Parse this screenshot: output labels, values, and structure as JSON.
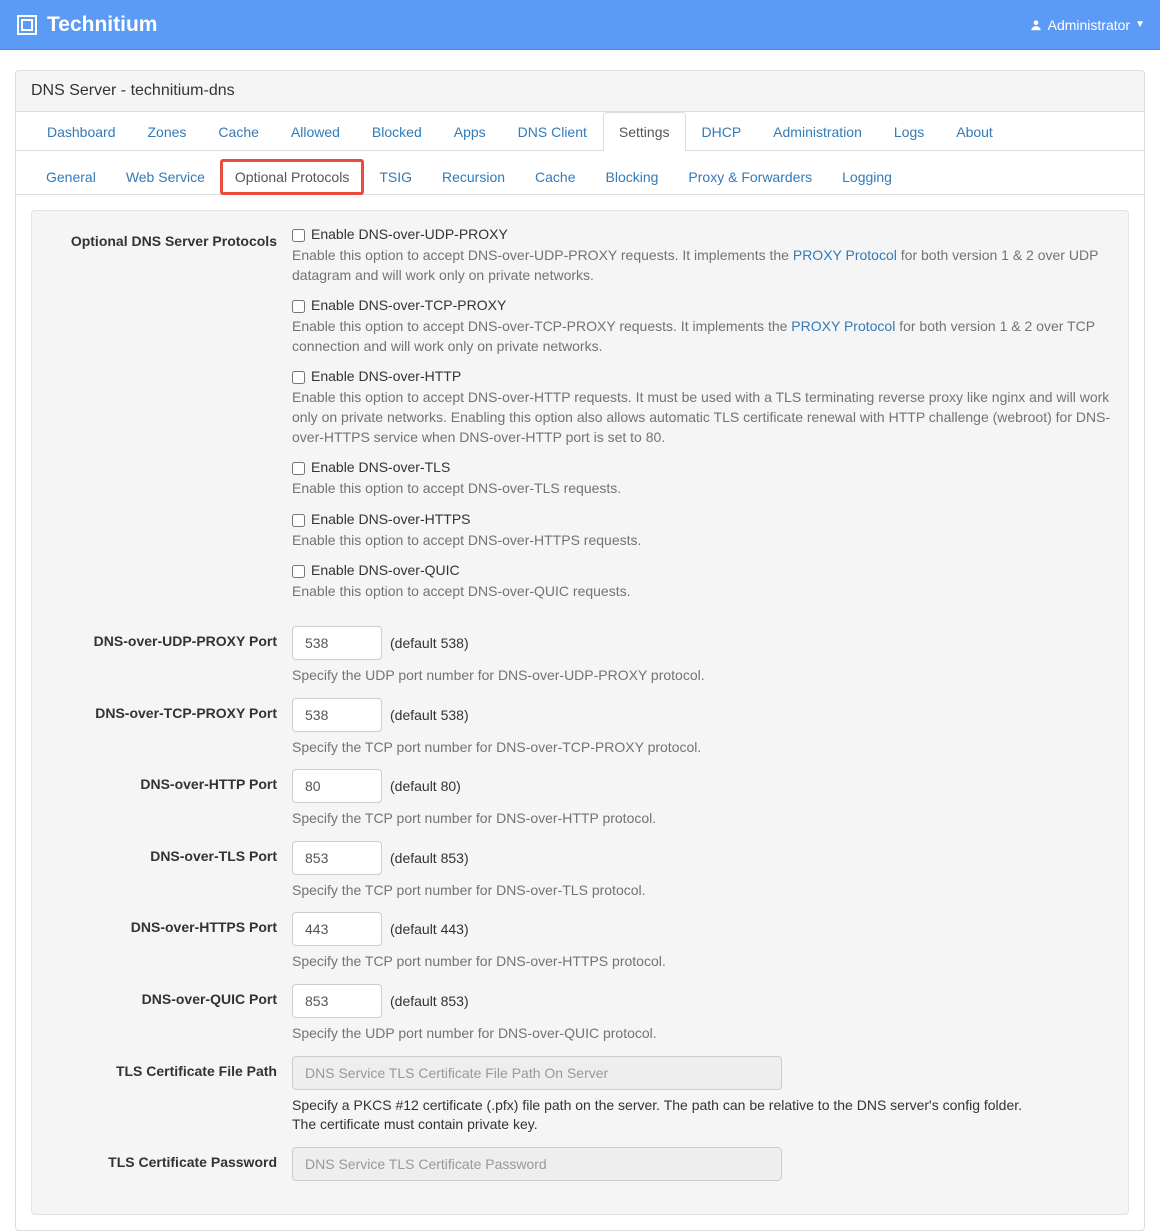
{
  "brand": "Technitium",
  "user": "Administrator",
  "page_title": "DNS Server - technitium-dns",
  "main_tabs": [
    {
      "label": "Dashboard"
    },
    {
      "label": "Zones"
    },
    {
      "label": "Cache"
    },
    {
      "label": "Allowed"
    },
    {
      "label": "Blocked"
    },
    {
      "label": "Apps"
    },
    {
      "label": "DNS Client"
    },
    {
      "label": "Settings",
      "active": true
    },
    {
      "label": "DHCP"
    },
    {
      "label": "Administration"
    },
    {
      "label": "Logs"
    },
    {
      "label": "About"
    }
  ],
  "sub_tabs": [
    {
      "label": "General"
    },
    {
      "label": "Web Service"
    },
    {
      "label": "Optional Protocols",
      "highlighted": true
    },
    {
      "label": "TSIG"
    },
    {
      "label": "Recursion"
    },
    {
      "label": "Cache"
    },
    {
      "label": "Blocking"
    },
    {
      "label": "Proxy & Forwarders"
    },
    {
      "label": "Logging"
    }
  ],
  "section_label": "Optional DNS Server Protocols",
  "proxy_link_label": "PROXY Protocol",
  "checkboxes": [
    {
      "label": "Enable DNS-over-UDP-PROXY",
      "help_pre": "Enable this option to accept DNS-over-UDP-PROXY requests. It implements the ",
      "help_post": "for both version 1 & 2 over UDP datagram and will work only on private networks.",
      "has_link": true
    },
    {
      "label": "Enable DNS-over-TCP-PROXY",
      "help_pre": "Enable this option to accept DNS-over-TCP-PROXY requests. It implements the ",
      "help_post": "for both version 1 & 2 over TCP connection and will work only on private networks.",
      "has_link": true
    },
    {
      "label": "Enable DNS-over-HTTP",
      "help_full": "Enable this option to accept DNS-over-HTTP requests. It must be used with a TLS terminating reverse proxy like nginx and will work only on private networks. Enabling this option also allows automatic TLS certificate renewal with HTTP challenge (webroot) for DNS-over-HTTPS service when DNS-over-HTTP port is set to 80."
    },
    {
      "label": "Enable DNS-over-TLS",
      "help_full": "Enable this option to accept DNS-over-TLS requests."
    },
    {
      "label": "Enable DNS-over-HTTPS",
      "help_full": "Enable this option to accept DNS-over-HTTPS requests."
    },
    {
      "label": "Enable DNS-over-QUIC",
      "help_full": "Enable this option to accept DNS-over-QUIC requests."
    }
  ],
  "ports": [
    {
      "label": "DNS-over-UDP-PROXY Port",
      "value": "538",
      "default": "(default 538)",
      "help": "Specify the UDP port number for DNS-over-UDP-PROXY protocol."
    },
    {
      "label": "DNS-over-TCP-PROXY Port",
      "value": "538",
      "default": "(default 538)",
      "help": "Specify the TCP port number for DNS-over-TCP-PROXY protocol."
    },
    {
      "label": "DNS-over-HTTP Port",
      "value": "80",
      "default": "(default 80)",
      "help": "Specify the TCP port number for DNS-over-HTTP protocol."
    },
    {
      "label": "DNS-over-TLS Port",
      "value": "853",
      "default": "(default 853)",
      "help": "Specify the TCP port number for DNS-over-TLS protocol."
    },
    {
      "label": "DNS-over-HTTPS Port",
      "value": "443",
      "default": "(default 443)",
      "help": "Specify the TCP port number for DNS-over-HTTPS protocol."
    },
    {
      "label": "DNS-over-QUIC Port",
      "value": "853",
      "default": "(default 853)",
      "help": "Specify the UDP port number for DNS-over-QUIC protocol."
    }
  ],
  "cert_path": {
    "label": "TLS Certificate File Path",
    "placeholder": "DNS Service TLS Certificate File Path On Server",
    "help": "Specify a PKCS #12 certificate (.pfx) file path on the server. The path can be relative to the DNS server's config folder. The certificate must contain private key."
  },
  "cert_pass": {
    "label": "TLS Certificate Password",
    "placeholder": "DNS Service TLS Certificate Password"
  }
}
